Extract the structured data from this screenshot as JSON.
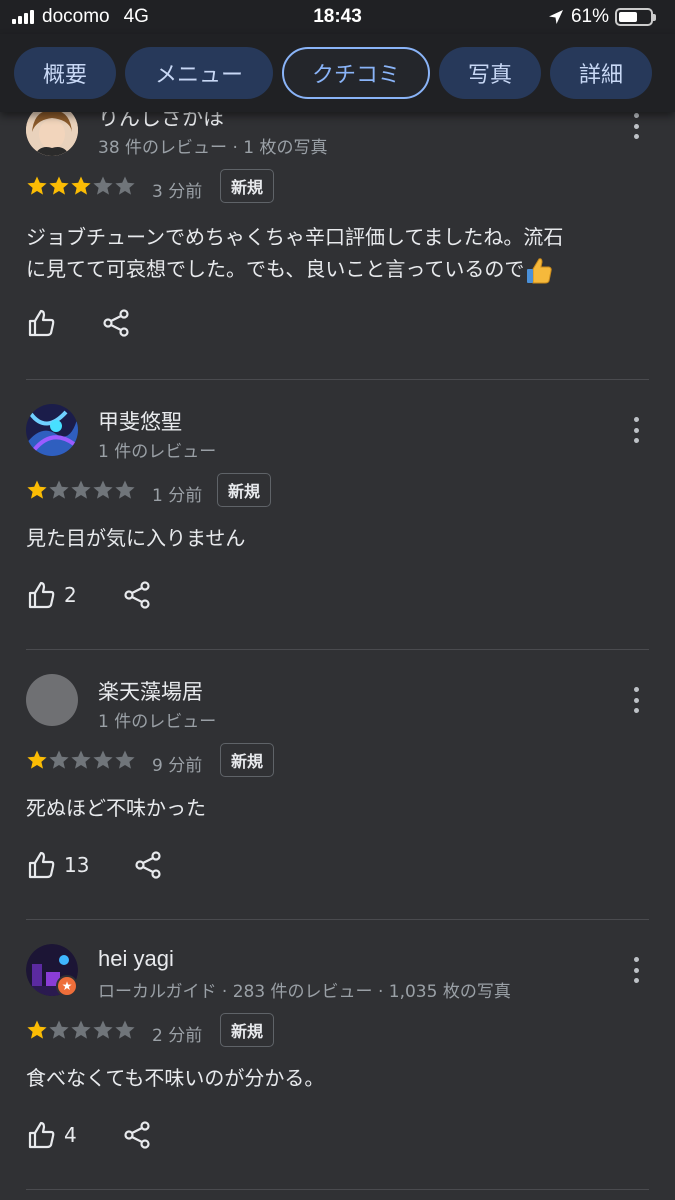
{
  "status_bar": {
    "carrier": "docomo",
    "network": "4G",
    "time": "18:43",
    "battery": "61%",
    "battery_level": 0.61
  },
  "tabs": [
    {
      "label": "概要",
      "active": false
    },
    {
      "label": "メニュー",
      "active": false
    },
    {
      "label": "クチコミ",
      "active": true
    },
    {
      "label": "写真",
      "active": false
    },
    {
      "label": "詳細",
      "active": false
    }
  ],
  "reviews": [
    {
      "name": "りんしさかほ",
      "meta": "38 件のレビュー · 1 枚の写真",
      "rating": 3,
      "age": "3 分前",
      "badge": "新規",
      "text_line1": "ジョブチューンでめちゃくちゃ辛口評価してましたね。流石",
      "text_line2": "に見てて可哀想でした。でも、良いこと言っているので",
      "text_emoji": "thumbs-up-emoji",
      "likes": ""
    },
    {
      "name": "甲斐悠聖",
      "meta": "1 件のレビュー",
      "rating": 1,
      "age": "1 分前",
      "badge": "新規",
      "text_line1": "見た目が気に入りません",
      "likes": "2"
    },
    {
      "name": "楽天藻場居",
      "meta": "1 件のレビュー",
      "rating": 1,
      "age": "9 分前",
      "badge": "新規",
      "text_line1": "死ぬほど不味かった",
      "likes": "13"
    },
    {
      "name": "hei yagi",
      "meta": "ローカルガイド · 283 件のレビュー · 1,035 枚の写真",
      "rating": 1,
      "age": "2 分前",
      "badge": "新規",
      "text_line1": "食べなくても不味いのが分かる。",
      "likes": "4"
    }
  ],
  "colors": {
    "background": "#303134",
    "header": "#202124",
    "tab_bg": "#27395a",
    "tab_active_border": "#8ab4f8",
    "star_filled": "#fbbc04",
    "star_empty": "#70757a"
  }
}
